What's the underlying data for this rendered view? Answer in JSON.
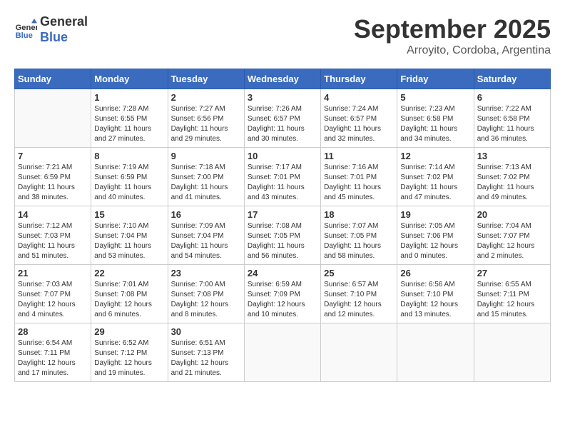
{
  "logo": {
    "line1": "General",
    "line2": "Blue"
  },
  "title": "September 2025",
  "subtitle": "Arroyito, Cordoba, Argentina",
  "days_header": [
    "Sunday",
    "Monday",
    "Tuesday",
    "Wednesday",
    "Thursday",
    "Friday",
    "Saturday"
  ],
  "weeks": [
    [
      {
        "day": "",
        "empty": true
      },
      {
        "day": "1",
        "sunrise": "7:28 AM",
        "sunset": "6:55 PM",
        "daylight": "11 hours and 27 minutes."
      },
      {
        "day": "2",
        "sunrise": "7:27 AM",
        "sunset": "6:56 PM",
        "daylight": "11 hours and 29 minutes."
      },
      {
        "day": "3",
        "sunrise": "7:26 AM",
        "sunset": "6:57 PM",
        "daylight": "11 hours and 30 minutes."
      },
      {
        "day": "4",
        "sunrise": "7:24 AM",
        "sunset": "6:57 PM",
        "daylight": "11 hours and 32 minutes."
      },
      {
        "day": "5",
        "sunrise": "7:23 AM",
        "sunset": "6:58 PM",
        "daylight": "11 hours and 34 minutes."
      },
      {
        "day": "6",
        "sunrise": "7:22 AM",
        "sunset": "6:58 PM",
        "daylight": "11 hours and 36 minutes."
      }
    ],
    [
      {
        "day": "7",
        "sunrise": "7:21 AM",
        "sunset": "6:59 PM",
        "daylight": "11 hours and 38 minutes."
      },
      {
        "day": "8",
        "sunrise": "7:19 AM",
        "sunset": "6:59 PM",
        "daylight": "11 hours and 40 minutes."
      },
      {
        "day": "9",
        "sunrise": "7:18 AM",
        "sunset": "7:00 PM",
        "daylight": "11 hours and 41 minutes."
      },
      {
        "day": "10",
        "sunrise": "7:17 AM",
        "sunset": "7:01 PM",
        "daylight": "11 hours and 43 minutes."
      },
      {
        "day": "11",
        "sunrise": "7:16 AM",
        "sunset": "7:01 PM",
        "daylight": "11 hours and 45 minutes."
      },
      {
        "day": "12",
        "sunrise": "7:14 AM",
        "sunset": "7:02 PM",
        "daylight": "11 hours and 47 minutes."
      },
      {
        "day": "13",
        "sunrise": "7:13 AM",
        "sunset": "7:02 PM",
        "daylight": "11 hours and 49 minutes."
      }
    ],
    [
      {
        "day": "14",
        "sunrise": "7:12 AM",
        "sunset": "7:03 PM",
        "daylight": "11 hours and 51 minutes."
      },
      {
        "day": "15",
        "sunrise": "7:10 AM",
        "sunset": "7:04 PM",
        "daylight": "11 hours and 53 minutes."
      },
      {
        "day": "16",
        "sunrise": "7:09 AM",
        "sunset": "7:04 PM",
        "daylight": "11 hours and 54 minutes."
      },
      {
        "day": "17",
        "sunrise": "7:08 AM",
        "sunset": "7:05 PM",
        "daylight": "11 hours and 56 minutes."
      },
      {
        "day": "18",
        "sunrise": "7:07 AM",
        "sunset": "7:05 PM",
        "daylight": "11 hours and 58 minutes."
      },
      {
        "day": "19",
        "sunrise": "7:05 AM",
        "sunset": "7:06 PM",
        "daylight": "12 hours and 0 minutes."
      },
      {
        "day": "20",
        "sunrise": "7:04 AM",
        "sunset": "7:07 PM",
        "daylight": "12 hours and 2 minutes."
      }
    ],
    [
      {
        "day": "21",
        "sunrise": "7:03 AM",
        "sunset": "7:07 PM",
        "daylight": "12 hours and 4 minutes."
      },
      {
        "day": "22",
        "sunrise": "7:01 AM",
        "sunset": "7:08 PM",
        "daylight": "12 hours and 6 minutes."
      },
      {
        "day": "23",
        "sunrise": "7:00 AM",
        "sunset": "7:08 PM",
        "daylight": "12 hours and 8 minutes."
      },
      {
        "day": "24",
        "sunrise": "6:59 AM",
        "sunset": "7:09 PM",
        "daylight": "12 hours and 10 minutes."
      },
      {
        "day": "25",
        "sunrise": "6:57 AM",
        "sunset": "7:10 PM",
        "daylight": "12 hours and 12 minutes."
      },
      {
        "day": "26",
        "sunrise": "6:56 AM",
        "sunset": "7:10 PM",
        "daylight": "12 hours and 13 minutes."
      },
      {
        "day": "27",
        "sunrise": "6:55 AM",
        "sunset": "7:11 PM",
        "daylight": "12 hours and 15 minutes."
      }
    ],
    [
      {
        "day": "28",
        "sunrise": "6:54 AM",
        "sunset": "7:11 PM",
        "daylight": "12 hours and 17 minutes."
      },
      {
        "day": "29",
        "sunrise": "6:52 AM",
        "sunset": "7:12 PM",
        "daylight": "12 hours and 19 minutes."
      },
      {
        "day": "30",
        "sunrise": "6:51 AM",
        "sunset": "7:13 PM",
        "daylight": "12 hours and 21 minutes."
      },
      {
        "day": "",
        "empty": true
      },
      {
        "day": "",
        "empty": true
      },
      {
        "day": "",
        "empty": true
      },
      {
        "day": "",
        "empty": true
      }
    ]
  ]
}
